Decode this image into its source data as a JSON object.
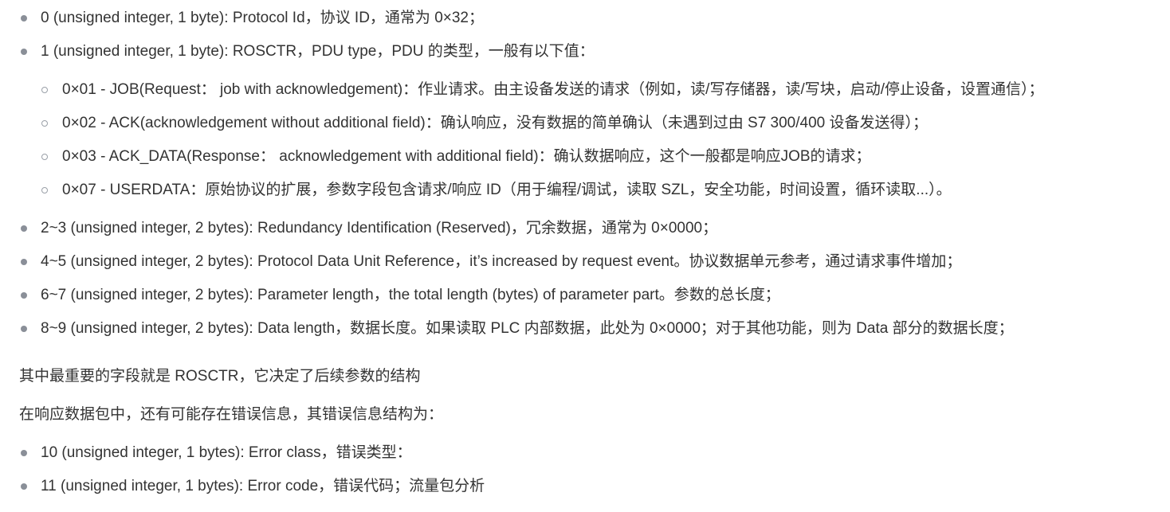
{
  "content": {
    "header_list": [
      {
        "text": "0 (unsigned integer, 1 byte): Protocol Id，协议 ID，通常为 0×32；"
      },
      {
        "text": "1 (unsigned integer, 1 byte): ROSCTR，PDU type，PDU 的类型，一般有以下值："
      }
    ],
    "rosctr_values": [
      {
        "text": "0×01 - JOB(Request： job with acknowledgement)：作业请求。由主设备发送的请求（例如，读/写存储器，读/写块，启动/停止设备，设置通信）；"
      },
      {
        "text": "0×02 - ACK(acknowledgement without additional field)：确认响应，没有数据的简单确认（未遇到过由 S7 300/400 设备发送得）；"
      },
      {
        "text": "0×03 - ACK_DATA(Response： acknowledgement with additional field)：确认数据响应，这个一般都是响应JOB的请求；"
      },
      {
        "text": "0×07 - USERDATA：原始协议的扩展，参数字段包含请求/响应 ID（用于编程/调试，读取 SZL，安全功能，时间设置，循环读取...）。"
      }
    ],
    "header_list_2": [
      {
        "text": "2~3 (unsigned integer, 2 bytes): Redundancy Identification (Reserved)，冗余数据，通常为 0×0000；"
      },
      {
        "text": "4~5 (unsigned integer, 2 bytes): Protocol Data Unit Reference，it’s increased by request event。协议数据单元参考，通过请求事件增加；"
      },
      {
        "text": "6~7 (unsigned integer, 2 bytes): Parameter length，the total length (bytes) of parameter part。参数的总长度；"
      },
      {
        "text": "8~9 (unsigned integer, 2 bytes): Data length，数据长度。如果读取 PLC 内部数据，此处为 0×0000；对于其他功能，则为 Data 部分的数据长度；"
      }
    ],
    "paragraph_1": "其中最重要的字段就是 ROSCTR，它决定了后续参数的结构",
    "paragraph_2": "在响应数据包中，还有可能存在错误信息，其错误信息结构为：",
    "error_list": [
      {
        "text": "10 (unsigned integer, 1 bytes): Error class，错误类型："
      },
      {
        "text": "11 (unsigned integer, 1 bytes): Error code，错误代码；流量包分析"
      }
    ]
  }
}
